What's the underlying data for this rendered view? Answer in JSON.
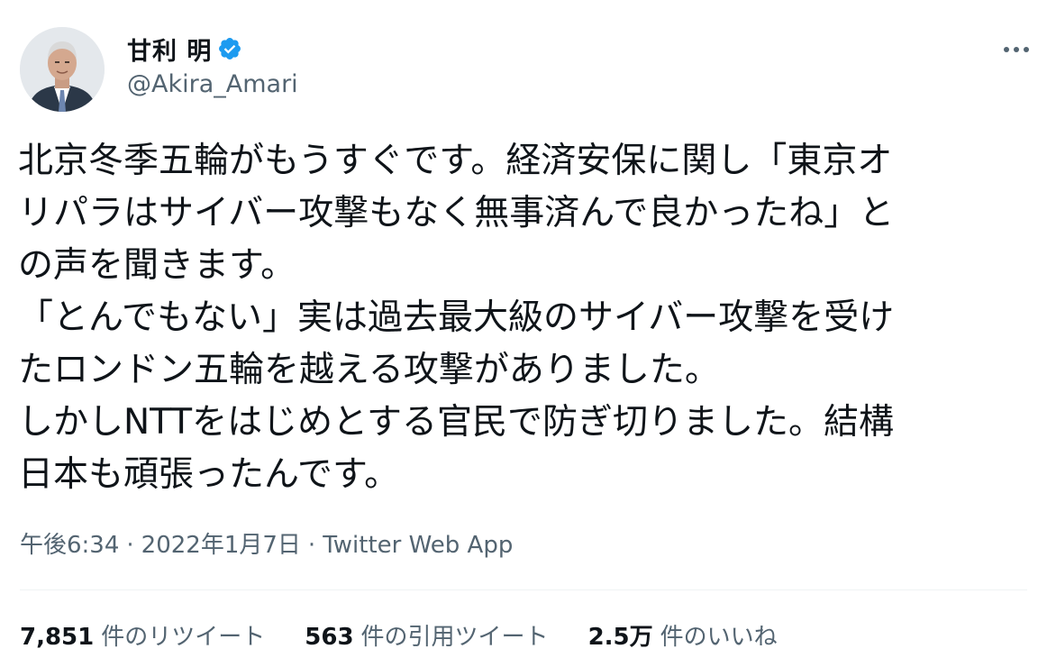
{
  "user": {
    "display_name": "甘利 明",
    "handle": "@Akira_Amari",
    "verified": true,
    "avatar_icon": "person-avatar-icon"
  },
  "more_icon": "more-horizontal-icon",
  "tweet": {
    "lines": [
      "北京冬季五輪がもうすぐです。経済安保に関し「東京オ",
      "リパラはサイバー攻撃もなく無事済んで良かったね」と",
      "の声を聞きます。",
      "「とんでもない」実は過去最大級のサイバー攻撃を受け",
      "たロンドン五輪を越える攻撃がありました。",
      "しかしNTTをはじめとする官民で防ぎ切りました。結構",
      "日本も頑張ったんです。"
    ]
  },
  "meta": {
    "time": "午後6:34",
    "separator": "·",
    "date": "2022年1月7日",
    "source": "Twitter Web App"
  },
  "stats": {
    "retweets_count": "7,851",
    "retweets_label": "件のリツイート",
    "quotes_count": "563",
    "quotes_label": "件の引用ツイート",
    "likes_count": "2.5万",
    "likes_label": "件のいいね"
  },
  "colors": {
    "text_primary": "#0f1419",
    "text_secondary": "#536471",
    "verified_blue": "#1d9bf0",
    "divider": "#eff3f4"
  }
}
